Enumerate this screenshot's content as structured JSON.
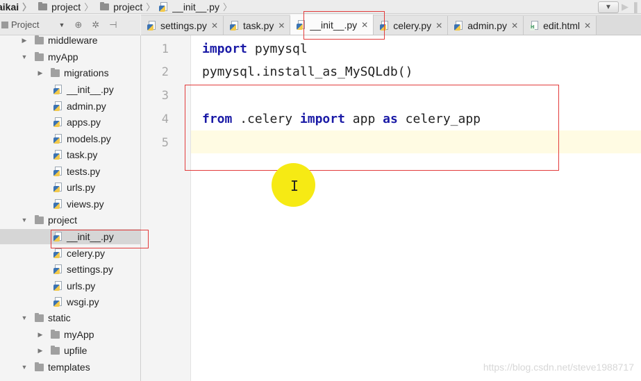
{
  "breadcrumb": [
    {
      "label": "aikai"
    },
    {
      "label": "project"
    },
    {
      "label": "project"
    },
    {
      "label": "__init__.py"
    }
  ],
  "project_toolbar": {
    "label": "Project"
  },
  "tabs": [
    {
      "label": "settings.py",
      "icon": "python-file-icon",
      "active": false
    },
    {
      "label": "task.py",
      "icon": "python-file-icon",
      "active": false
    },
    {
      "label": "__init__.py",
      "icon": "python-file-icon",
      "active": true
    },
    {
      "label": "celery.py",
      "icon": "python-file-icon",
      "active": false
    },
    {
      "label": "admin.py",
      "icon": "python-file-icon",
      "active": false
    },
    {
      "label": "edit.html",
      "icon": "html-file-icon",
      "active": false
    }
  ],
  "tree": [
    {
      "label": "middleware",
      "type": "folder",
      "state": "collapsed"
    },
    {
      "label": "myApp",
      "type": "folder",
      "state": "expanded"
    },
    {
      "label": "migrations",
      "type": "folder",
      "state": "collapsed"
    },
    {
      "label": "__init__.py",
      "type": "file"
    },
    {
      "label": "admin.py",
      "type": "file"
    },
    {
      "label": "apps.py",
      "type": "file"
    },
    {
      "label": "models.py",
      "type": "file"
    },
    {
      "label": "task.py",
      "type": "file"
    },
    {
      "label": "tests.py",
      "type": "file"
    },
    {
      "label": "urls.py",
      "type": "file"
    },
    {
      "label": "views.py",
      "type": "file"
    },
    {
      "label": "project",
      "type": "folder",
      "state": "expanded"
    },
    {
      "label": "__init__.py",
      "type": "file",
      "selected": true
    },
    {
      "label": "celery.py",
      "type": "file"
    },
    {
      "label": "settings.py",
      "type": "file"
    },
    {
      "label": "urls.py",
      "type": "file"
    },
    {
      "label": "wsgi.py",
      "type": "file"
    },
    {
      "label": "static",
      "type": "folder",
      "state": "expanded"
    },
    {
      "label": "myApp",
      "type": "folder",
      "state": "collapsed"
    },
    {
      "label": "upfile",
      "type": "folder",
      "state": "collapsed"
    },
    {
      "label": "templates",
      "type": "folder",
      "state": "expanded"
    }
  ],
  "editor": {
    "line_numbers": [
      "1",
      "2",
      "3",
      "4",
      "5"
    ],
    "line1": {
      "kw1": "import",
      "rest": " pymysql"
    },
    "line2": {
      "text": "pymysql.install_as_MySQLdb()"
    },
    "line4": {
      "kw1": "from",
      "mid1": " .celery ",
      "kw2": "import",
      "mid2": " app ",
      "kw3": "as",
      "rest": " celery_app"
    }
  },
  "watermark": "https://blog.csdn.net/steve1988717",
  "colors": {
    "keyword": "#1a1aa6",
    "annotation_box": "#e23b3b",
    "cursor_highlight": "#f6ea14",
    "current_line": "#fffbe3"
  }
}
